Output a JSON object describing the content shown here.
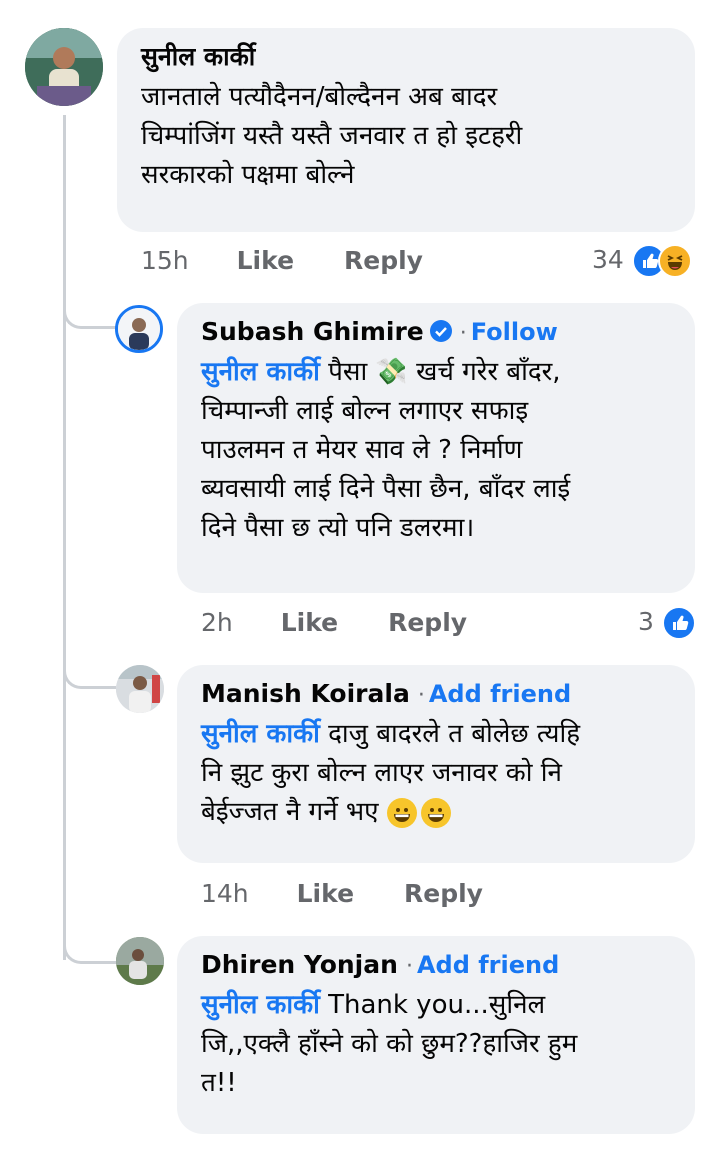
{
  "comments": [
    {
      "author": "सुनील कार्की",
      "text_lines": [
        "जानताले पत्यौदैनन/बोल्दैनन अब बादर",
        "चिम्पांजिंग यस्तै यस्तै जनवार त हो इटहरी",
        "सरकारको पक्षमा बोल्ने"
      ],
      "time": "15h",
      "like_label": "Like",
      "reply_label": "Reply",
      "reaction_count": "34",
      "reaction_icons": [
        "like-icon",
        "haha-icon"
      ]
    },
    {
      "author": "Subash Ghimire",
      "verified": true,
      "follow_label": "Follow",
      "mention": "सुनील कार्की",
      "text_lines": [
        "पैसा 💸 खर्च गरेर बाँदर,",
        "चिम्पान्जी लाई बोल्न लगाएर सफाइ",
        "पाउलमन त मेयर साव ले ? निर्माण",
        "ब्यवसायी लाई दिने पैसा छैन, बाँदर लाई",
        "दिने पैसा छ त्यो पनि डलरमा।"
      ],
      "time": "2h",
      "like_label": "Like",
      "reply_label": "Reply",
      "reaction_count": "3",
      "reaction_icons": [
        "like-icon"
      ]
    },
    {
      "author": "Manish Koirala",
      "follow_label": "Add friend",
      "mention": "सुनील कार्की",
      "text_lines": [
        "दाजु बादरले त बोलेछ त्यहि",
        "नि झुट कुरा बोल्न लाएर जनावर को नि",
        "बेईज्जत नै गर्ने भए"
      ],
      "emojis": [
        "grinning-emoji",
        "grinning-emoji"
      ],
      "time": "14h",
      "like_label": "Like",
      "reply_label": "Reply"
    },
    {
      "author": "Dhiren Yonjan",
      "follow_label": "Add friend",
      "mention": "सुनील कार्की",
      "text_lines": [
        "Thank you...सुनिल",
        "जि,,एक्लै हाँस्ने को को छुम??हाजिर हुम",
        "त!!"
      ]
    }
  ],
  "colors": {
    "link": "#1877f2",
    "bubble": "#f0f2f5",
    "meta": "#65676b"
  }
}
